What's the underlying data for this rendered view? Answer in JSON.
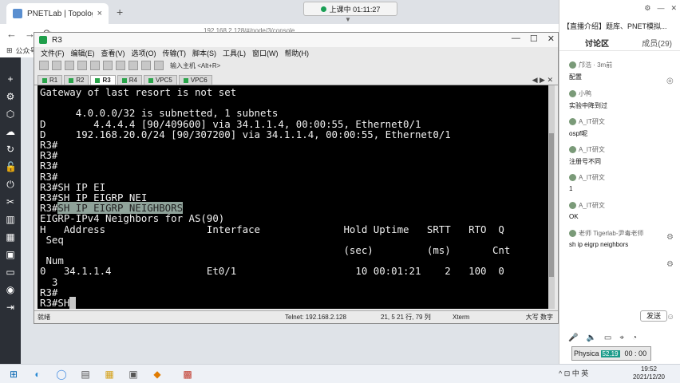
{
  "browser": {
    "tab_title": "PNETLab | Topology",
    "tab_close": "×",
    "new_tab": "+",
    "url": "192.168.2.128/#/node/3/console",
    "bookmark_label": "公众号",
    "meeting_status": "上课中 01:11:27",
    "meeting_arrow": "▼"
  },
  "terminal_window": {
    "title": "R3",
    "menu": [
      "文件(F)",
      "编辑(E)",
      "查看(V)",
      "选项(O)",
      "传输(T)",
      "脚本(S)",
      "工具(L)",
      "窗口(W)",
      "帮助(H)"
    ],
    "toolbar_hint": "输入主机 <Alt+R>",
    "tabs": [
      "R1",
      "R2",
      "R3",
      "R4",
      "VPC5",
      "VPC6"
    ],
    "active_tab": "R3",
    "tab_nav": "◀ ▶ ✕",
    "terminal_lines": [
      "Gateway of last resort is not set",
      "",
      "      4.0.0.0/32 is subnetted, 1 subnets",
      "D        4.4.4.4 [90/409600] via 34.1.1.4, 00:00:55, Ethernet0/1",
      "D     192.168.20.0/24 [90/307200] via 34.1.1.4, 00:00:55, Ethernet0/1",
      "R3#",
      "R3#",
      "R3#",
      "R3#",
      "R3#SH IP EI",
      "R3#SH IP EIGRP NEI"
    ],
    "highlight_prompt": "R3#",
    "highlight_cmd": "SH IP EIGRP NEIGHBORS",
    "terminal_lines_after": [
      "EIGRP-IPv4 Neighbors for AS(90)",
      "H   Address                 Interface              Hold Uptime   SRTT   RTO  Q",
      " Seq",
      "                                                   (sec)         (ms)       Cnt",
      " Num",
      "0   34.1.1.4                Et0/1                    10 00:01:21    2   100  0",
      "  3",
      "R3#"
    ],
    "last_prompt": "R3#SH",
    "status": {
      "ready": "就绪",
      "telnet": "Telnet: 192.168.2.128",
      "position": "21,  5  21 行, 79 列",
      "term": "Xterm",
      "caps": "大写  数字"
    }
  },
  "chat": {
    "top_title": "【直播介绍】题库、PNET模拟...",
    "top_controls": [
      "⚙",
      "—",
      "✕"
    ],
    "header": "",
    "tab_discuss": "讨论区",
    "tab_members": "成员(29)",
    "messages": [
      {
        "user": "邝浩 · 3m前",
        "text": "配置"
      },
      {
        "user": "小鸭",
        "text": "实验中降到过"
      },
      {
        "user": "A_IT研文",
        "text": "ospf呢"
      },
      {
        "user": "A_IT研文",
        "text": "注册号不同"
      },
      {
        "user": "A_IT研文",
        "text": "1"
      },
      {
        "user": "A_IT研文",
        "text": "OK"
      },
      {
        "user": "老师 Tigerlab-尹毒老师",
        "text": "sh ip eigrp neighbors"
      }
    ],
    "send_label": "发送",
    "physical_label": "Physica",
    "physical_tag": "52.19",
    "physical_time": "00 : 00"
  },
  "taskbar": {
    "tray": "^  ⊡  中  英",
    "time": "19:52",
    "date": "2021/12/20"
  }
}
